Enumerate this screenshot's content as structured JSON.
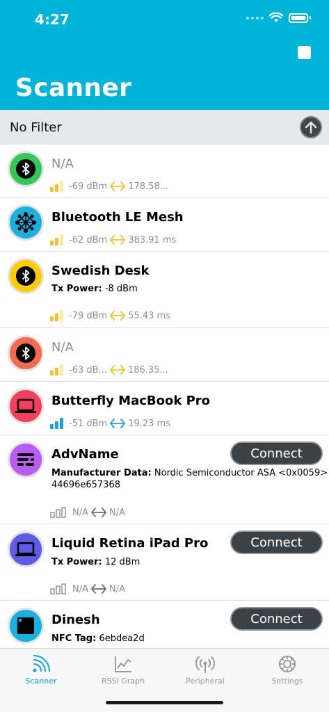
{
  "status": {
    "time": "4:27"
  },
  "header": {
    "title": "Scanner"
  },
  "filter": {
    "label": "No Filter"
  },
  "colors": {
    "header": "#00b4d8",
    "accent_cyan": "#0aa6cf",
    "signal_yellow": "#f2c230",
    "signal_cyan": "#1aa3d6",
    "signal_grey": "#8e8e93"
  },
  "devices": [
    {
      "name": "N/A",
      "rssi": "-69 dBm",
      "interval": "178.58...",
      "icon": "bluetooth-icon",
      "color": "#34c759",
      "named": false
    },
    {
      "name": "Bluetooth LE Mesh",
      "rssi": "-62 dBm",
      "interval": "383.91 ms",
      "icon": "mesh-network-icon",
      "color": "#1ab0e0",
      "named": true
    },
    {
      "name": "Swedish Desk",
      "detail_label": "Tx Power:",
      "detail_value": "-8 dBm",
      "rssi": "-79 dBm",
      "interval": "55.43 ms",
      "icon": "bluetooth-icon",
      "color": "#ffcc00",
      "named": true
    },
    {
      "name": "N/A",
      "rssi": "-63 dB...",
      "interval": "186.35...",
      "icon": "bluetooth-icon",
      "color": "#f26b4f",
      "named": false
    },
    {
      "name": "Butterfly MacBook Pro",
      "rssi": "-51 dBm",
      "interval": "19.23 ms",
      "icon": "laptop-icon",
      "color": "#f23f5e",
      "named": true
    },
    {
      "name": "AdvName",
      "detail_label": "Manufacturer Data:",
      "detail_value": "Nordic Semiconductor ASA <0x0059>",
      "detail_line2": "44696e657368",
      "rssi": "N/A",
      "interval": "N/A",
      "icon": "settings-sliders-icon",
      "color": "#b95cf0",
      "named": true,
      "connect": "Connect"
    },
    {
      "name": "Liquid Retina iPad Pro",
      "detail_label": "Tx Power:",
      "detail_value": "12 dBm",
      "rssi": "N/A",
      "interval": "N/A",
      "icon": "laptop-icon",
      "color": "#5e5ce6",
      "named": true,
      "connect": "Connect"
    },
    {
      "name": "Dinesh",
      "detail_label": "NFC Tag:",
      "detail_value": "6ebdea2d",
      "icon": "chip-icon",
      "color": "#1ab0e0",
      "named": true,
      "connect": "Connect"
    }
  ],
  "tabs": [
    {
      "label": "Scanner",
      "icon": "scanner-icon",
      "active": true
    },
    {
      "label": "RSSI Graph",
      "icon": "graph-icon",
      "active": false
    },
    {
      "label": "Peripheral",
      "icon": "antenna-icon",
      "active": false
    },
    {
      "label": "Settings",
      "icon": "gear-icon",
      "active": false
    }
  ]
}
